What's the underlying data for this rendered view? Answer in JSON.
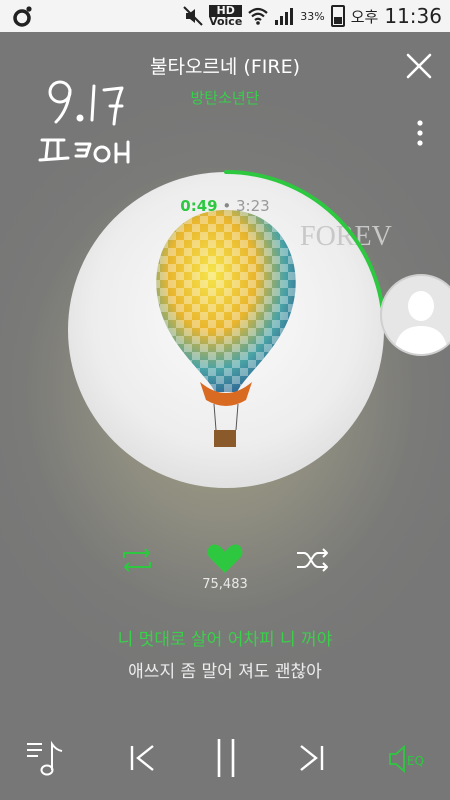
{
  "status_bar": {
    "hd_line1": "HD",
    "hd_line2": "Voice",
    "battery": "33%",
    "ampm": "오후",
    "time": "11:36"
  },
  "header": {
    "title": "불타오르네 (FIRE)",
    "artist": "방탄소년단"
  },
  "player": {
    "current_time": "0:49",
    "separator": "•",
    "total_time": "3:23",
    "progress": 0.241,
    "likes": "75,483"
  },
  "lyrics": {
    "current": "니 멋대로 살어 어차피 니 꺼야",
    "next": "애쓰지 좀 말어 져도 괜찮아"
  },
  "colors": {
    "accent": "#2ec840",
    "text": "#ffffff"
  }
}
